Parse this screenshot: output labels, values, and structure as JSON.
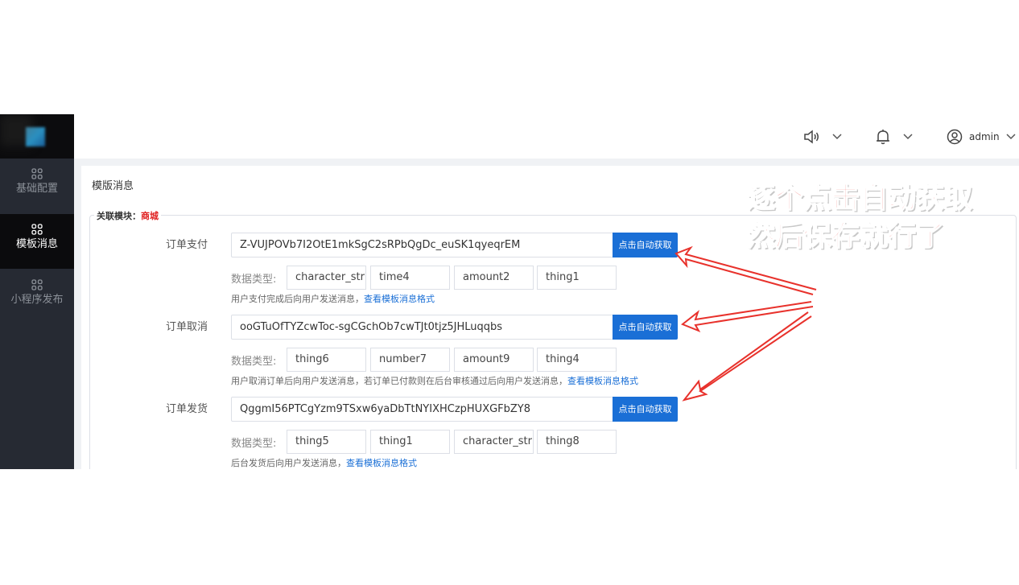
{
  "header": {
    "user_label": "admin"
  },
  "sidebar": {
    "items": [
      {
        "label": "基础配置"
      },
      {
        "label": "模板消息"
      },
      {
        "label": "小程序发布"
      }
    ]
  },
  "page": {
    "title": "模版消息",
    "module_prefix": "关联模块：",
    "module_name": "商城"
  },
  "templates": [
    {
      "label": "订单支付",
      "value": "Z-VUJPOVb7I2OtE1mkSgC2sRPbQgDc_euSK1qyeqrEM",
      "button": "点击自动获取",
      "type_label": "数据类型:",
      "types": [
        "character_stri",
        "time4",
        "amount2",
        "thing1"
      ],
      "help_text": "用户支付完成后向用户发送消息，",
      "help_link": "查看模板消息格式"
    },
    {
      "label": "订单取消",
      "value": "ooGTuOfTYZcwToc-sgCGchOb7cwTJt0tjz5JHLuqqbs",
      "button": "点击自动获取",
      "type_label": "数据类型:",
      "types": [
        "thing6",
        "number7",
        "amount9",
        "thing4"
      ],
      "help_text": "用户取消订单后向用户发送消息，若订单已付款则在后台审核通过后向用户发送消息，",
      "help_link": "查看模板消息格式"
    },
    {
      "label": "订单发货",
      "value": "QggmI56PTCgYzm9TSxw6yaDbTtNYIXHCzpHUXGFbZY8",
      "button": "点击自动获取",
      "type_label": "数据类型:",
      "types": [
        "thing5",
        "thing1",
        "character_stri",
        "thing8"
      ],
      "help_text": "后台发货后向用户发送消息，",
      "help_link": "查看模板消息格式"
    }
  ],
  "annotation": {
    "line1": "逐个点击自动获取",
    "line2": "然后保存就行了",
    "color": "#e8322c"
  },
  "colors": {
    "sidebar_bg": "#262a33",
    "primary": "#1a6fd6",
    "accent_red": "#e02020"
  }
}
